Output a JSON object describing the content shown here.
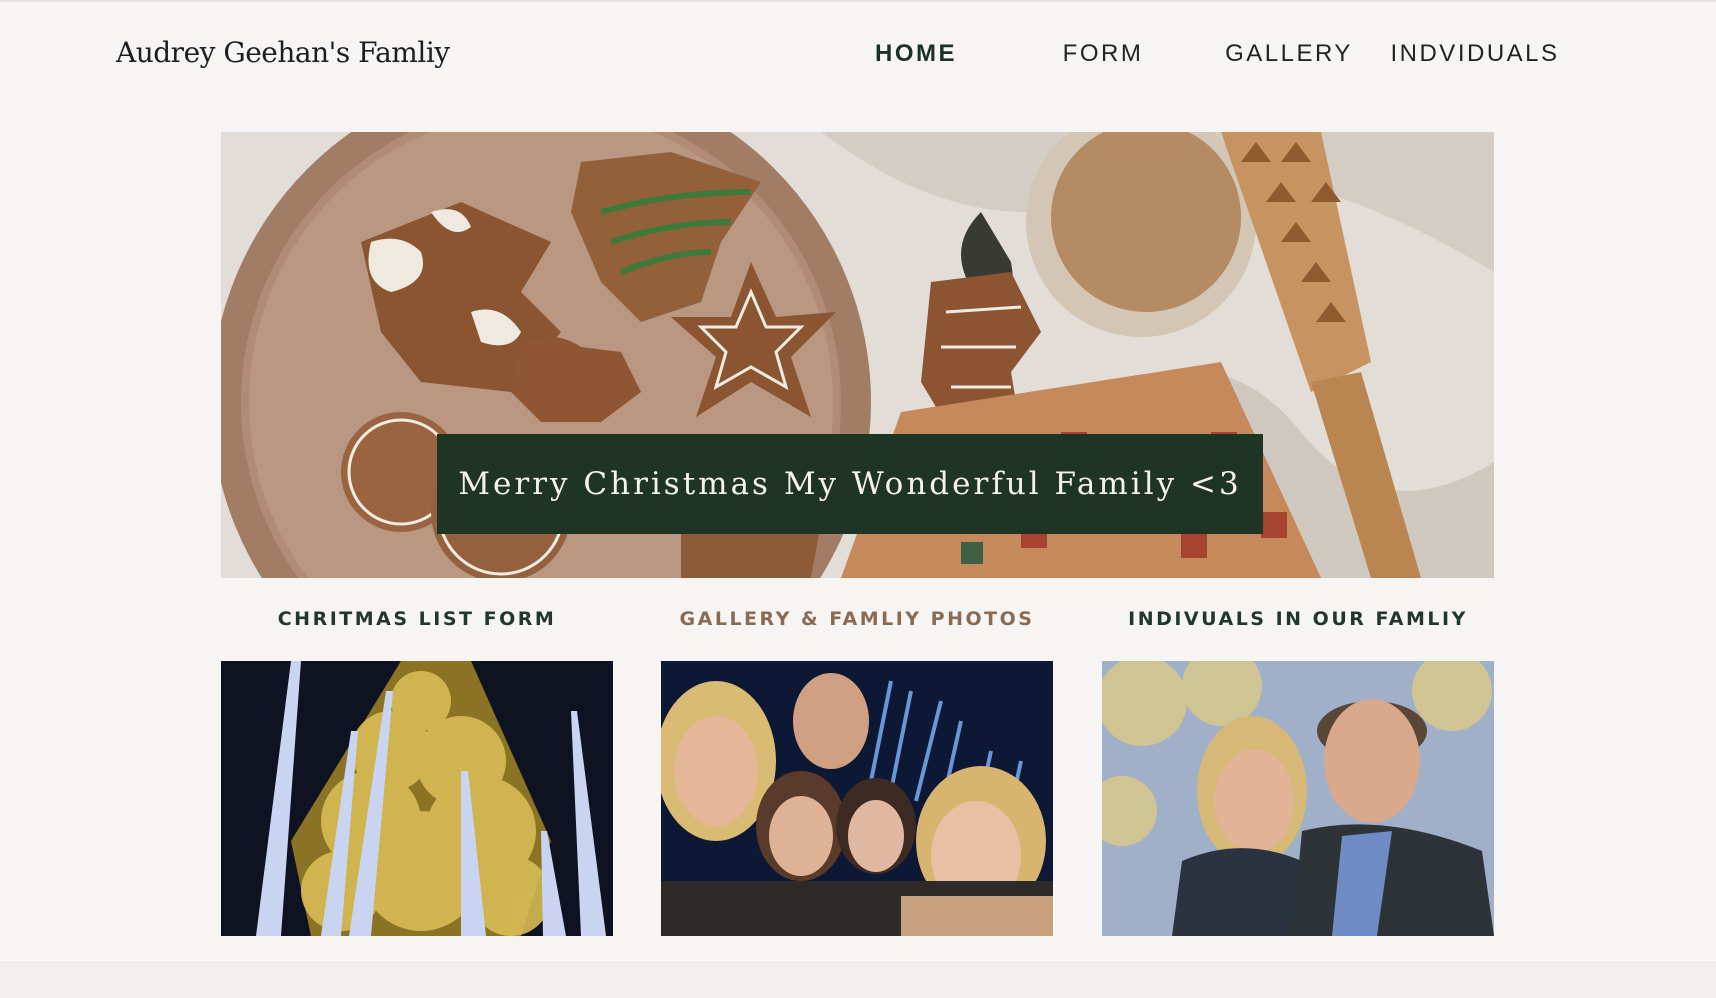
{
  "site": {
    "title": "Audrey Geehan's Famliy"
  },
  "nav": {
    "items": [
      {
        "label": "HOME",
        "active": true
      },
      {
        "label": "FORM",
        "active": false
      },
      {
        "label": "GALLERY",
        "active": false
      },
      {
        "label": "INDVIDUALS",
        "active": false
      }
    ]
  },
  "hero": {
    "banner_text": "Merry Christmas My Wonderful Family <3",
    "image_subject": "gingerbread cookies, coffee mug, rolling pin"
  },
  "cards": [
    {
      "title": "CHRITMAS LIST FORM",
      "image_subject": "lit christmas tree",
      "accent": false
    },
    {
      "title": "GALLERY & FAMLIY PHOTOS",
      "image_subject": "family selfie",
      "accent": true
    },
    {
      "title": "INDIVUALS IN OUR FAMLIY",
      "image_subject": "couple selfie",
      "accent": false
    }
  ],
  "colors": {
    "background": "#f7f5f4",
    "banner": "#1e3526",
    "heading": "#22392a",
    "accent_heading": "#8a6a52"
  }
}
